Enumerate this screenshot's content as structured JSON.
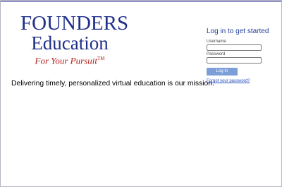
{
  "logo": {
    "line1": "FOUNDERS",
    "line2": "Education",
    "tagline": "For Your Pursuit",
    "trademark": "TM"
  },
  "mission": "Delivering timely, personalized virtual education is our mission.",
  "login": {
    "title": "Log in to get started",
    "username_label": "Username",
    "username_value": "",
    "password_label": "Password",
    "password_value": "",
    "button_label": "Log In",
    "forgot_link": "Forgot your password?"
  },
  "colors": {
    "brand_blue": "#1f2f8a",
    "tagline_red": "#b4201e",
    "button_blue": "#7d9fd8",
    "link_blue": "#2a4fbf",
    "top_bar": "#8f8fc6"
  }
}
